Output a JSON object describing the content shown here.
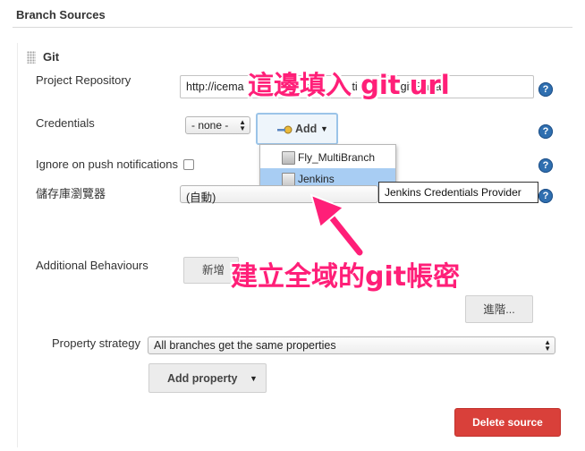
{
  "section": {
    "title": "Branch Sources"
  },
  "git": {
    "title": "Git",
    "project_repository": {
      "label": "Project Repository",
      "value": "http://icema    f fau   ti   /_git/Bana"
    },
    "credentials": {
      "label": "Credentials",
      "select_value": "- none -",
      "add_button_label": "Add",
      "dropdown_items": [
        "Fly_MultiBranch",
        "Jenkins"
      ],
      "tooltip": "Jenkins Credentials Provider"
    },
    "ignore_push": {
      "label": "Ignore on push notifications"
    },
    "repo_browser": {
      "label": "儲存庫瀏覽器",
      "value": "(自動)"
    },
    "additional_behaviours": {
      "label": "Additional Behaviours",
      "add_label": "新增"
    },
    "advanced_label": "進階..."
  },
  "property_strategy": {
    "label": "Property strategy",
    "value": "All branches get the same properties",
    "add_property_label": "Add property"
  },
  "delete_source_label": "Delete source",
  "annotations": {
    "top": "這邊填入 git url",
    "middle": "建立全域的git帳密"
  },
  "colors": {
    "annotation": "#ff1f78",
    "danger": "#d9403a",
    "help": "#2f6fb0"
  }
}
